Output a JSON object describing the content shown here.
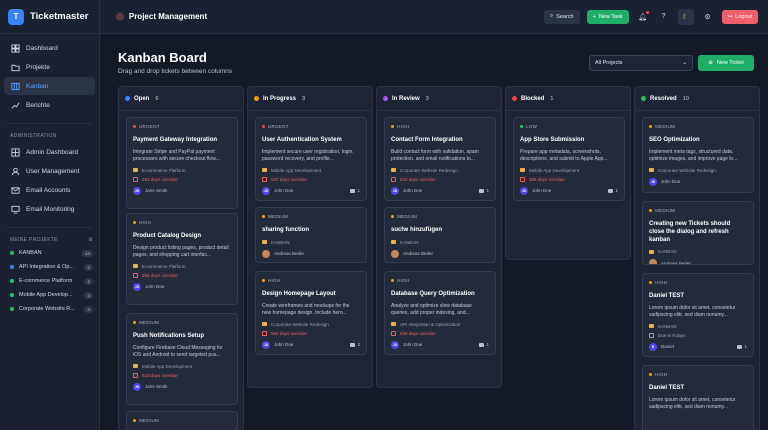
{
  "brand": {
    "logo": "T",
    "name": "Ticketmaster"
  },
  "sidebar": {
    "items": [
      {
        "label": "Dashboard",
        "icon": "dashboard-icon"
      },
      {
        "label": "Projekte",
        "icon": "folder-icon"
      },
      {
        "label": "Kanban",
        "icon": "kanban-icon"
      },
      {
        "label": "Berichte",
        "icon": "chart-icon"
      }
    ],
    "admin_title": "ADMINISTRATION",
    "admin_items": [
      {
        "label": "Admin Dashboard"
      },
      {
        "label": "User Management"
      },
      {
        "label": "Email Accounts"
      },
      {
        "label": "Email Monitoring"
      }
    ],
    "projects_title": "MEINE PROJEKTE",
    "projects": [
      {
        "name": "KANBAN",
        "count": "14",
        "color": "#22c55e"
      },
      {
        "name": "API Integration & Op...",
        "count": "2",
        "color": "#3b82f6"
      },
      {
        "name": "E-commerce Platform",
        "count": "2",
        "color": "#22c55e"
      },
      {
        "name": "Mobile App Develop...",
        "count": "2",
        "color": "#22c55e"
      },
      {
        "name": "Corporate Website R...",
        "count": "4",
        "color": "#22c55e"
      }
    ]
  },
  "topbar": {
    "title": "Project Management",
    "search": "Search",
    "new_task": "New Task",
    "logout": "Logout"
  },
  "page": {
    "title": "Kanban Board",
    "subtitle": "Drag and drop tickets between columns",
    "filter": "All Projects",
    "new_ticket": "New Ticket"
  },
  "columns": [
    {
      "title": "Open",
      "count": "6",
      "color": "#3b82f6",
      "cards": [
        {
          "priority": "URGENT",
          "pcolor": "#ef4444",
          "title": "Payment Gateway Integration",
          "desc": "Integrate Stripe and PayPal payment processors with secure checkout flow...",
          "project": "E-commerce Platform",
          "due": "482 days overdue",
          "overdue": true,
          "avatar": "JS",
          "user": "Jane Smith",
          "comments": ""
        },
        {
          "priority": "HIGH",
          "pcolor": "#f59e0b",
          "title": "Product Catalog Design",
          "desc": "Design product listing pages, product detail pages, and shopping cart interfac...",
          "project": "E-commerce Platform",
          "due": "586 days overdue",
          "overdue": true,
          "avatar": "JD",
          "user": "John Doe",
          "comments": ""
        },
        {
          "priority": "MEDIUM",
          "pcolor": "#f59e0b",
          "title": "Push Notifications Setup",
          "desc": "Configure Firebase Cloud Messaging for iOS and Android to send targeted pus...",
          "project": "Mobile App Development",
          "due": "523 days overdue",
          "overdue": true,
          "avatar": "JS",
          "user": "Jane Smith",
          "comments": ""
        }
      ],
      "tail": "MEDIUM"
    },
    {
      "title": "In Progress",
      "count": "3",
      "color": "#f59e0b",
      "cards": [
        {
          "priority": "URGENT",
          "pcolor": "#ef4444",
          "title": "User Authentication System",
          "desc": "Implement secure user registration, login, password recovery, and profile...",
          "project": "Mobile App Development",
          "due": "537 days overdue",
          "overdue": true,
          "avatar": "JD",
          "user": "John Doe",
          "comments": "1"
        },
        {
          "priority": "MEDIUM",
          "pcolor": "#f59e0b",
          "title": "sharing function",
          "desc": "",
          "project": "KANBAN",
          "due": "",
          "overdue": false,
          "avatar": "AB",
          "user": "Andreas Beder",
          "comments": "",
          "photo": true
        },
        {
          "priority": "HIGH",
          "pcolor": "#f59e0b",
          "title": "Design Homepage Layout",
          "desc": "Create wireframes and mockups for the new homepage design. Include hero...",
          "project": "Corporate Website Redesign",
          "due": "552 days overdue",
          "overdue": true,
          "avatar": "JD",
          "user": "John Doe",
          "comments": "3"
        }
      ]
    },
    {
      "title": "In Review",
      "count": "3",
      "color": "#a855f7",
      "cards": [
        {
          "priority": "HIGH",
          "pcolor": "#f59e0b",
          "title": "Contact Form Integration",
          "desc": "Build contact form with validation, spam protection, and email notifications to...",
          "project": "Corporate Website Redesign",
          "due": "542 days overdue",
          "overdue": true,
          "avatar": "JD",
          "user": "John Doe",
          "comments": "1"
        },
        {
          "priority": "MEDIUM",
          "pcolor": "#f59e0b",
          "title": "suche hinzufügen",
          "desc": "",
          "project": "KANBAN",
          "due": "",
          "overdue": false,
          "avatar": "AB",
          "user": "Andreas Beder",
          "comments": "",
          "photo": true
        },
        {
          "priority": "HIGH",
          "pcolor": "#f59e0b",
          "title": "Database Query Optimization",
          "desc": "Analyze and optimize slow database queries, add proper indexing, and...",
          "project": "API Integration & Optimization",
          "due": "508 days overdue",
          "overdue": true,
          "avatar": "JD",
          "user": "John Doe",
          "comments": "1"
        }
      ]
    },
    {
      "title": "Blocked",
      "count": "1",
      "color": "#ef4444",
      "cards": [
        {
          "priority": "LOW",
          "pcolor": "#22c55e",
          "title": "App Store Submission",
          "desc": "Prepare app metadata, screenshots, descriptions, and submit to Apple App...",
          "project": "Mobile App Development",
          "due": "386 days overdue",
          "overdue": true,
          "avatar": "JD",
          "user": "John Doe",
          "comments": "1"
        }
      ]
    },
    {
      "title": "Resolved",
      "count": "10",
      "color": "#22c55e",
      "cards": [
        {
          "priority": "MEDIUM",
          "pcolor": "#f59e0b",
          "title": "SEO Optimization",
          "desc": "Implement meta tags, structured data, optimize images, and improve page lo...",
          "project": "Corporate Website Redesign",
          "due": "",
          "overdue": false,
          "avatar": "JD",
          "user": "John Doe",
          "comments": ""
        },
        {
          "priority": "MEDIUM",
          "pcolor": "#f59e0b",
          "title": "Creating new Tickets should close the dialog and refresh kanban",
          "desc": "",
          "project": "KANBAN",
          "due": "",
          "overdue": false,
          "avatar": "AB",
          "user": "Andreas Beder",
          "comments": "",
          "photo": true
        },
        {
          "priority": "HIGH",
          "pcolor": "#f59e0b",
          "title": "Daniel TEST",
          "desc": "Lorem ipsum dolor sit amet, consetetur sadipscing elitr, sed diam nonumy...",
          "project": "KANBAN",
          "due": "Due in 9 days",
          "overdue": false,
          "avatar": "D",
          "user": "Daniel",
          "comments": "1"
        },
        {
          "priority": "HIGH",
          "pcolor": "#f59e0b",
          "title": "Daniel TEST",
          "desc": "Lorem ipsum dolor sit amet, consetetur sadipscing elitr, sed diam nonumy...",
          "project": "",
          "due": "",
          "overdue": false,
          "avatar": "",
          "user": "",
          "comments": ""
        }
      ]
    }
  ]
}
